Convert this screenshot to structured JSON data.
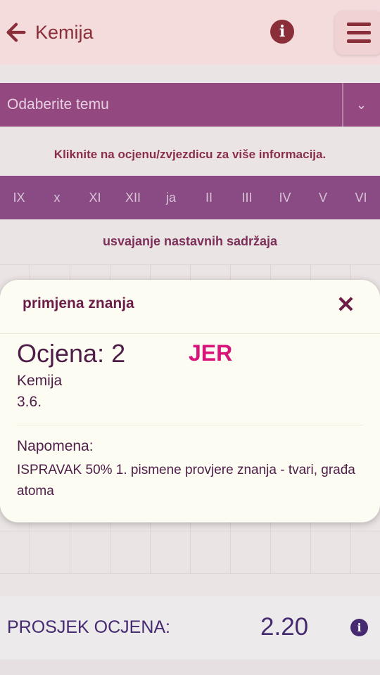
{
  "header": {
    "title": "Kemija",
    "back_icon": "arrow-left-icon",
    "info_icon": "info-icon",
    "menu_icon": "hamburger-menu-icon"
  },
  "topic_select": {
    "placeholder": "Odaberite temu",
    "chevron_icon": "chevron-down-icon"
  },
  "hint": "Kliknite na ocjenu/zvjezdicu za više informacija.",
  "months": [
    "IX",
    "x",
    "XI",
    "XII",
    "ja",
    "II",
    "III",
    "IV",
    "V",
    "VI"
  ],
  "section_title": "usvajanje nastavnih sadržaja",
  "modal": {
    "title": "primjena znanja",
    "grade_line": "Ocjena: 2",
    "teacher": "JER",
    "subject": "Kemija",
    "date": "3.6.",
    "note_label": "Napomena:",
    "note_text": "ISPRAVAK 50% 1. pismene provjere znanja - tvari, građa atoma"
  },
  "average": {
    "label": "PROSJEK OCJENA:",
    "value": "2.20"
  },
  "colors": {
    "accent": "#8a2f3a",
    "purple": "#93497f",
    "teacher": "#d8137a",
    "average_text": "#452a72"
  }
}
